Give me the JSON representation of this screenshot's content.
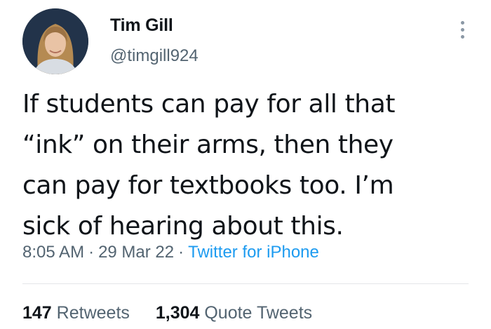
{
  "author": {
    "display_name": "Tim Gill",
    "handle": "@timgill924",
    "avatar_icon": "profile-photo"
  },
  "menu": {
    "icon": "more-vertical-icon"
  },
  "tweet": {
    "lines": [
      "If students can pay for all that",
      "“ink” on their arms, then they",
      "can pay for textbooks too. I’m",
      "sick of hearing about this."
    ]
  },
  "meta": {
    "time": "8:05 AM",
    "separator": "·",
    "date": "29 Mar 22",
    "source": "Twitter for iPhone"
  },
  "stats": {
    "retweets_count": "147",
    "retweets_label": "Retweets",
    "quotes_count": "1,304",
    "quotes_label": "Quote Tweets"
  },
  "colors": {
    "text": "#0f1419",
    "secondary": "#536471",
    "link": "#1d9bf0"
  }
}
